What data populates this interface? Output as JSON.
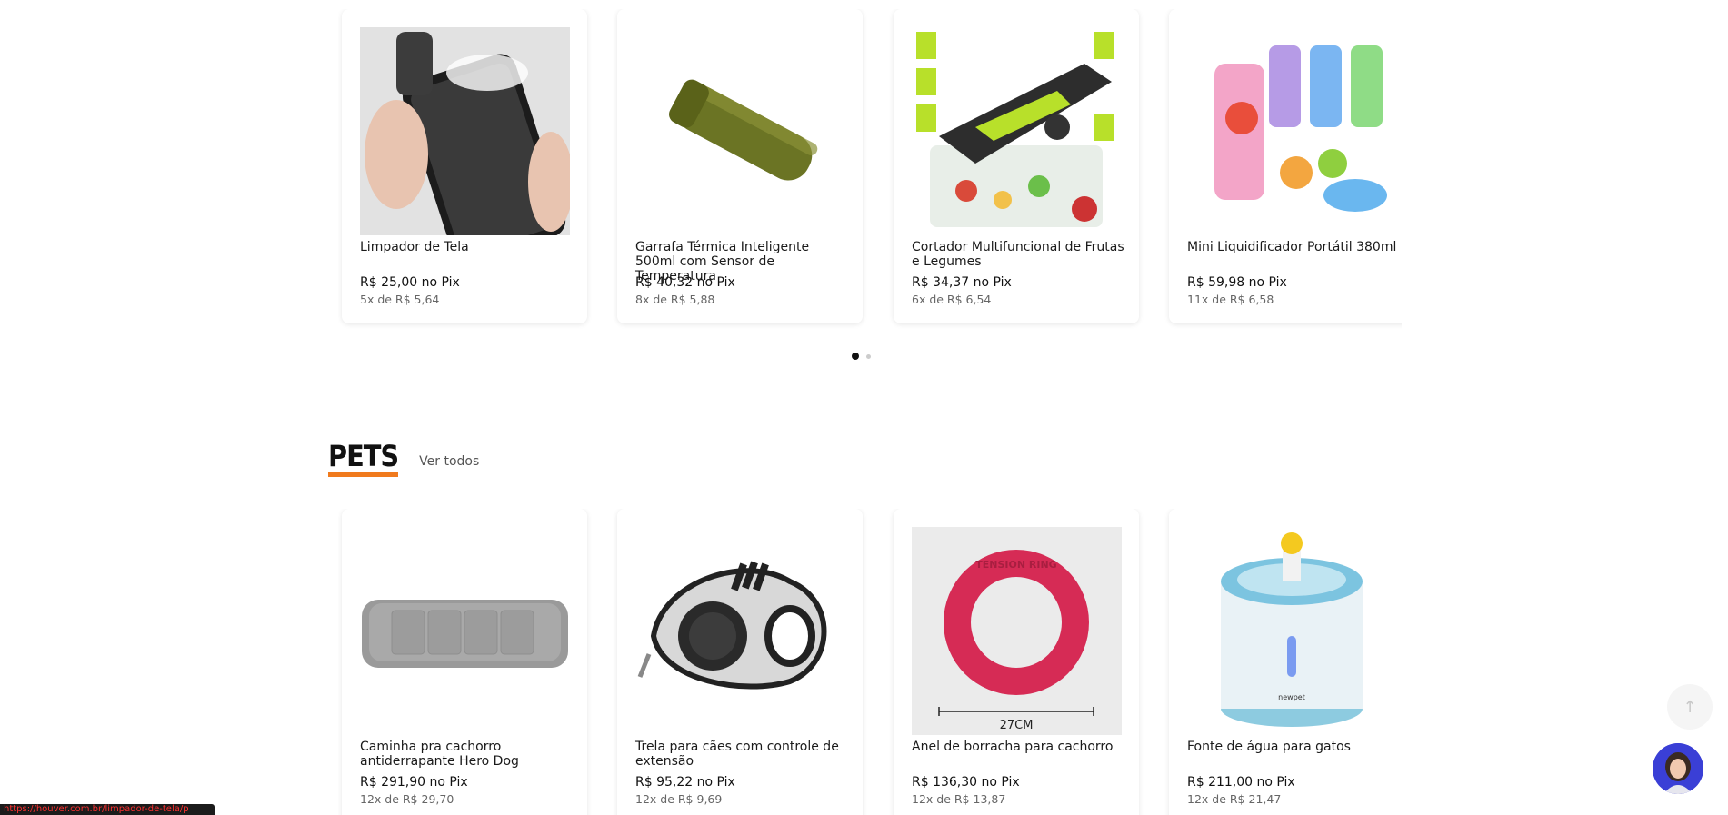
{
  "section_top": {
    "products": [
      {
        "name": "Limpador de Tela",
        "price": "R$ 25,00 no Pix",
        "installments": "5x de R$ 5,64",
        "image": "screen-cleaner-image"
      },
      {
        "name": "Garrafa Térmica Inteligente 500ml com Sensor de Temperatura",
        "price": "R$ 40,32 no Pix",
        "installments": "8x de R$ 5,88",
        "image": "thermal-bottle-image"
      },
      {
        "name": "Cortador Multifuncional de Frutas e Legumes",
        "price": "R$ 34,37 no Pix",
        "installments": "6x de R$ 6,54",
        "image": "vegetable-cutter-image"
      },
      {
        "name": "Mini Liquidificador Portátil 380ml",
        "price": "R$ 59,98 no Pix",
        "installments": "11x de R$ 6,58",
        "image": "portable-blender-image"
      }
    ],
    "carousel_pages": 2,
    "carousel_active": 1
  },
  "section_pets": {
    "title": "PETS",
    "see_all": "Ver todos",
    "products": [
      {
        "name": "Caminha pra cachorro antiderrapante Hero Dog",
        "price": "R$ 291,90 no Pix",
        "installments": "12x de R$ 29,70",
        "image": "dog-bed-image"
      },
      {
        "name": "Trela para cães com controle de extensão",
        "price": "R$ 95,22 no Pix",
        "installments": "12x de R$ 9,69",
        "image": "dog-leash-image"
      },
      {
        "name": "Anel de borracha para cachorro",
        "price": "R$ 136,30 no Pix",
        "installments": "12x de R$ 13,87",
        "image": "rubber-ring-image",
        "image_text": [
          "TENSION RING",
          "27CM"
        ]
      },
      {
        "name": "Fonte de água para gatos",
        "price": "R$ 211,00 no Pix",
        "installments": "12x de R$ 21,47",
        "image": "water-fountain-image",
        "image_text": [
          "newpet"
        ]
      }
    ]
  },
  "status_url": "https://houver.com.br/limpador-de-tela/p",
  "colors": {
    "accent": "#f07a1d",
    "chat_button": "#3a3fd6"
  }
}
